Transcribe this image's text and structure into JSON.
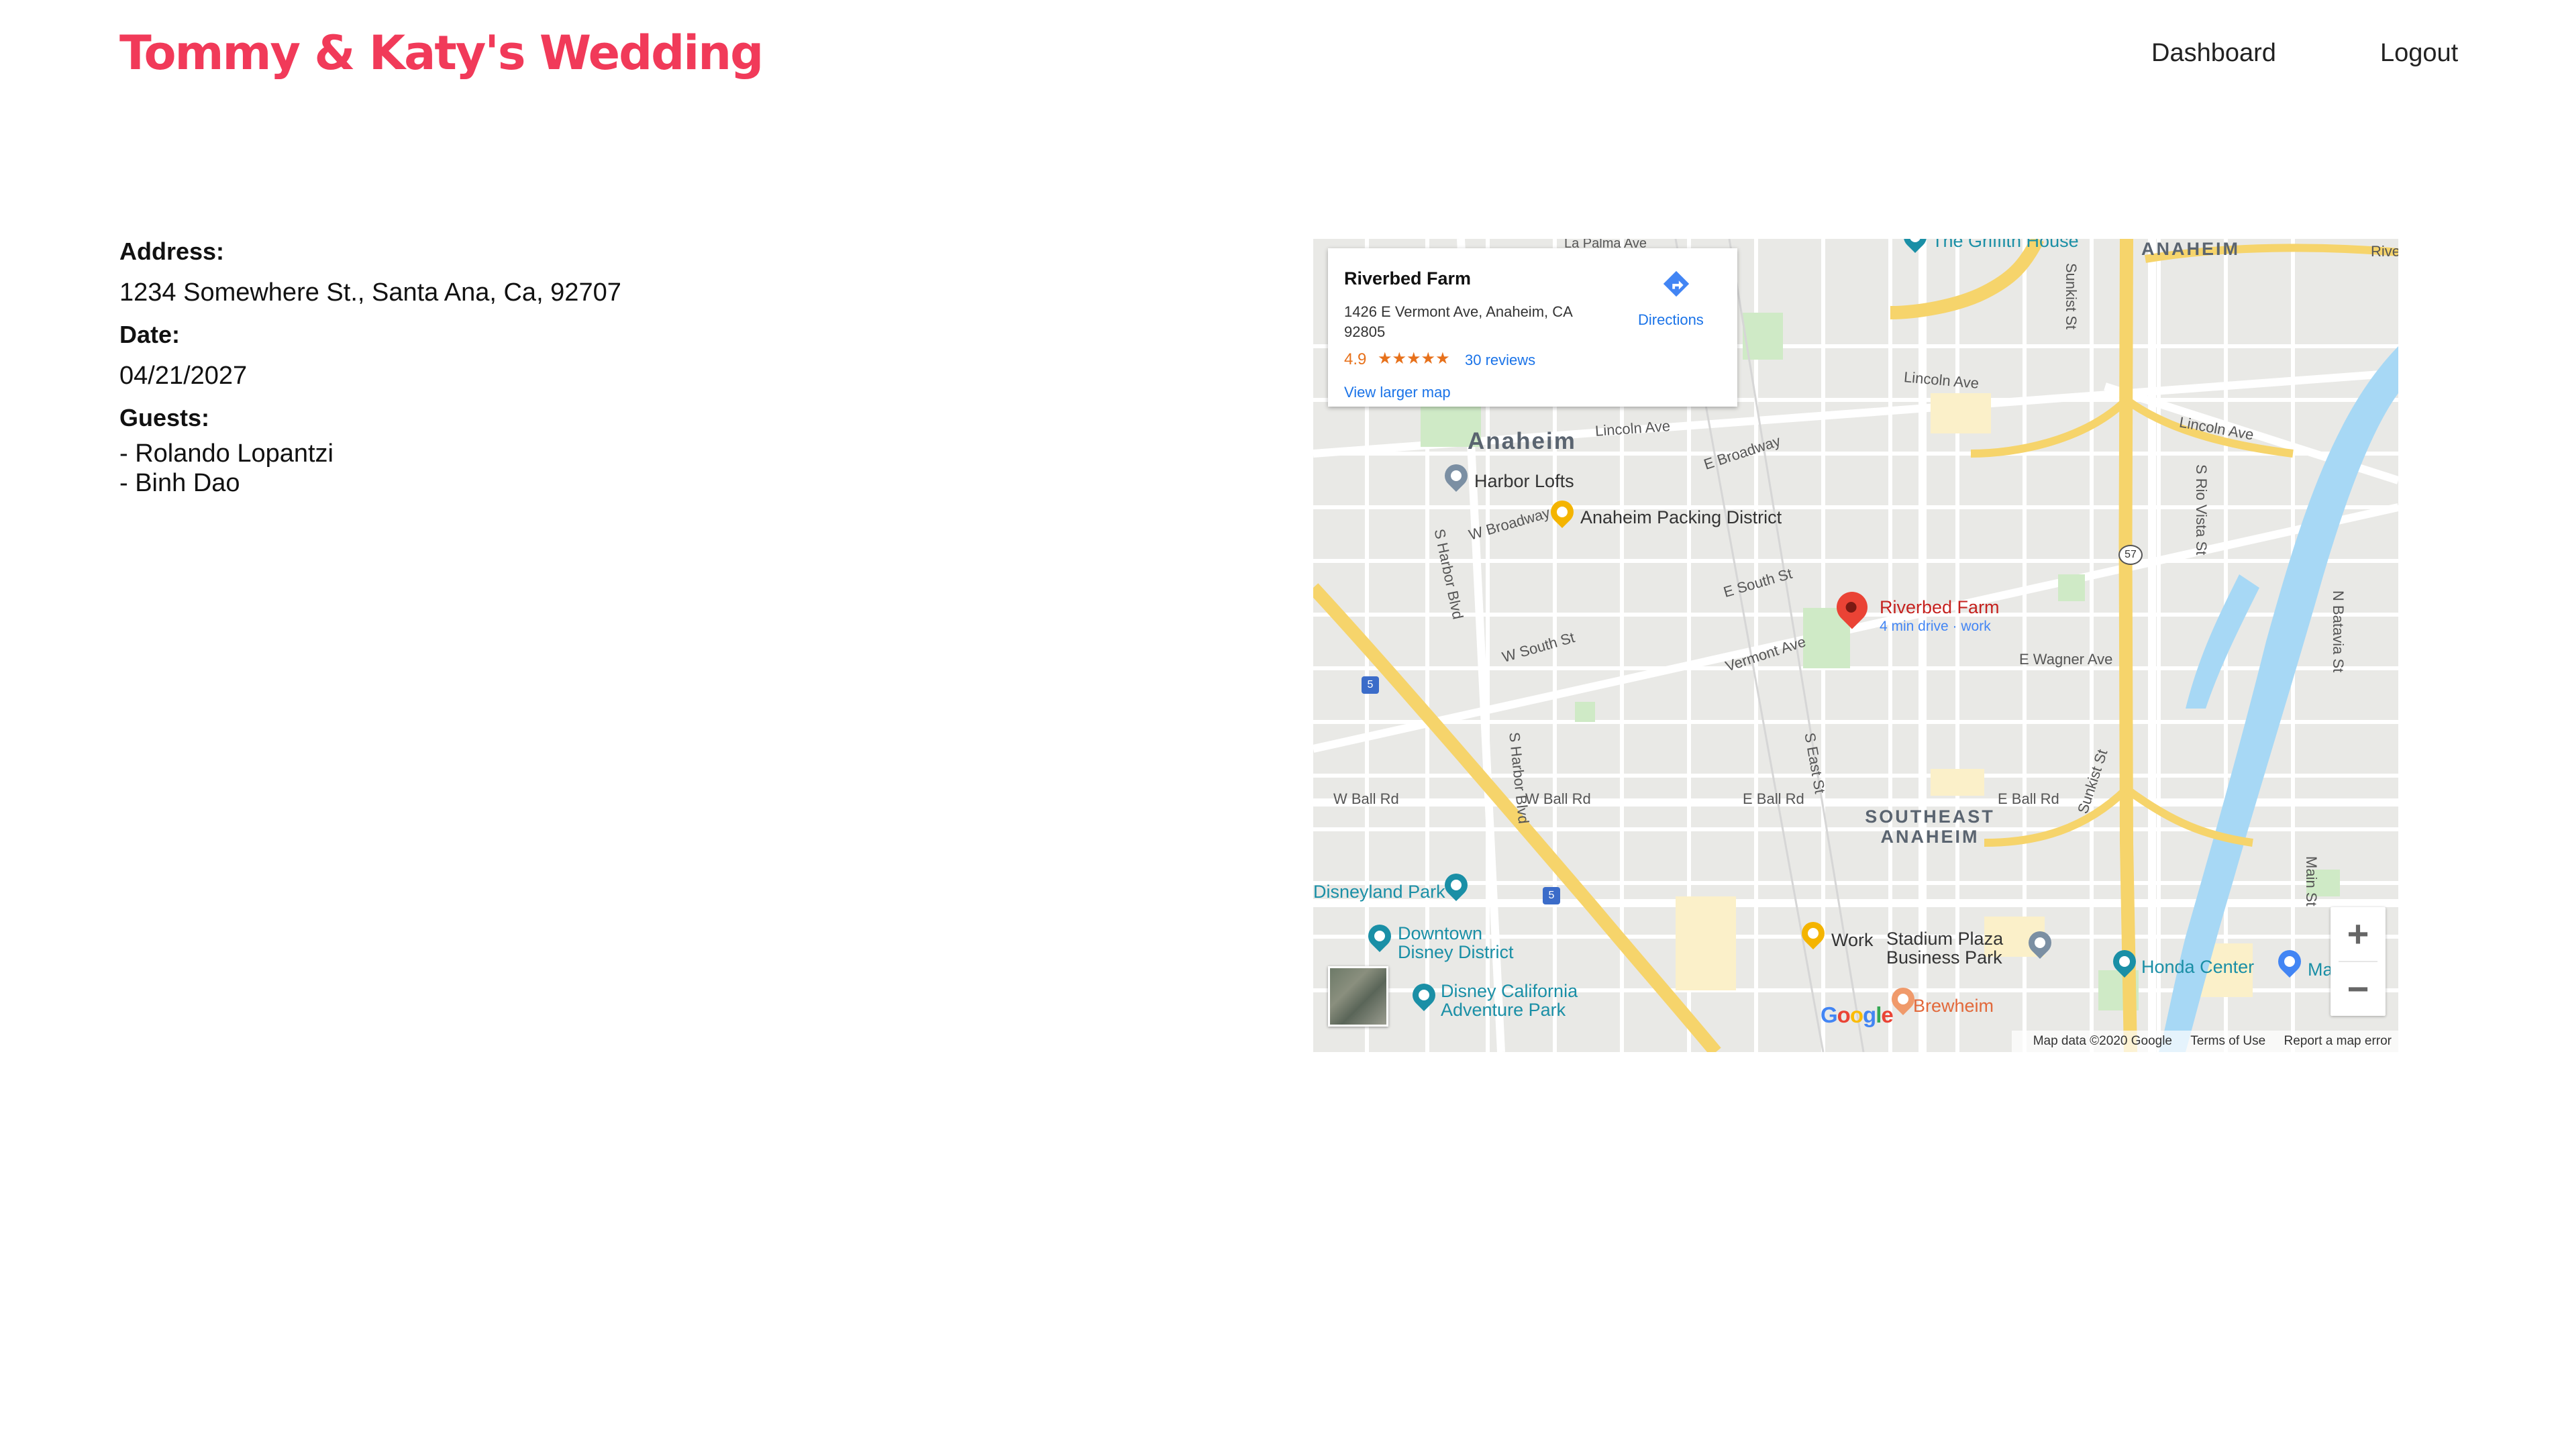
{
  "header": {
    "title": "Tommy & Katy's Wedding",
    "nav": [
      "Dashboard",
      "Logout"
    ]
  },
  "details": {
    "address_label": "Address:",
    "address": "1234 Somewhere St., Santa Ana, Ca, 92707",
    "date_label": "Date:",
    "date": "04/21/2027",
    "guests_label": "Guests:",
    "guests": [
      "- Rolando Lopantzi",
      "- Binh Dao"
    ]
  },
  "map": {
    "infobox": {
      "name": "Riverbed Farm",
      "address": "1426 E Vermont Ave, Anaheim, CA 92805",
      "rating": "4.9",
      "stars": "★★★★★",
      "reviews": "30 reviews",
      "view_larger": "View larger map",
      "directions": "Directions"
    },
    "marker": {
      "name": "Riverbed Farm",
      "subtitle": "4 min drive · work"
    },
    "cities": [
      "Anaheim",
      "ANAHEIM",
      "SOUTHEAST",
      "ANAHEIM"
    ],
    "streets": [
      "La Palma Ave",
      "Lincoln Ave",
      "Lincoln Ave",
      "Lincoln Ave",
      "E Broadway",
      "W Broadway",
      "E South St",
      "W South St",
      "Vermont Ave",
      "E Wagner Ave",
      "W Ball Rd",
      "W Ball Rd",
      "E Ball Rd",
      "E Ball Rd",
      "S Harbor Blvd",
      "S Harbor Blvd",
      "S East St",
      "Sunkist St",
      "Sunkist St",
      "S Rio Vista St",
      "N Batavia St",
      "Main St",
      "Rive"
    ],
    "pois": [
      "The Griffith House",
      "Harbor Lofts",
      "Anaheim Packing District",
      "Disneyland Park",
      "Downtown",
      "Disney District",
      "Disney California",
      "Adventure Park",
      "Work",
      "Stadium Plaza",
      "Business Park",
      "Brewheim",
      "Honda Center",
      "Ma"
    ],
    "shields": [
      "5",
      "5",
      "57"
    ],
    "footer": {
      "data": "Map data ©2020 Google",
      "terms": "Terms of Use",
      "report": "Report a map error"
    },
    "logo": "Google",
    "colors": {
      "highway": "#f6d46b",
      "water": "#a7d8f5",
      "park": "#cfeac6",
      "marker": "#ea4335",
      "brand": "#f13a59"
    }
  }
}
